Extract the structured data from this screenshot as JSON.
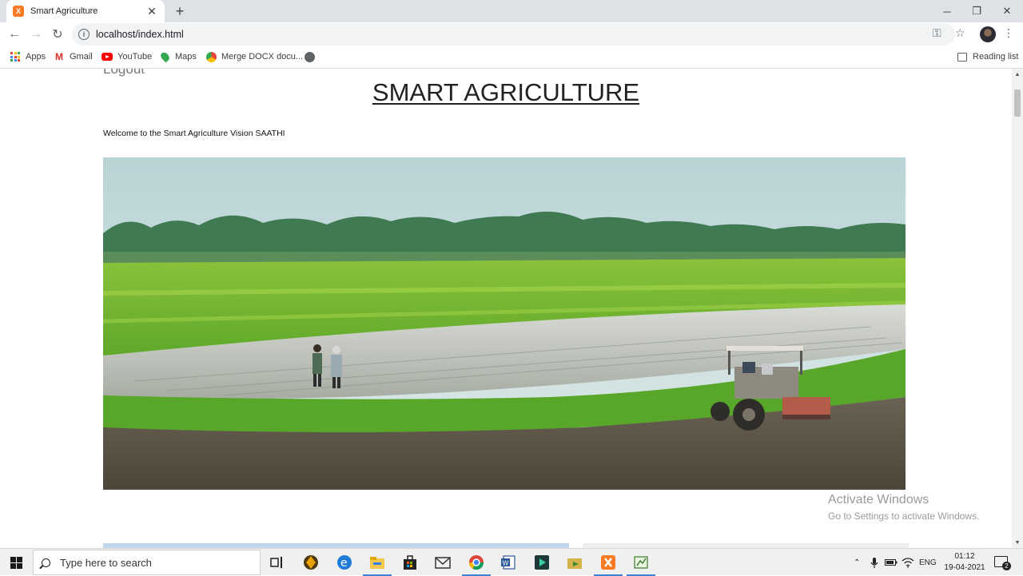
{
  "browser": {
    "tab": {
      "title": "Smart Agriculture",
      "favicon_text": "X"
    },
    "url": "localhost/index.html",
    "bookmarks": [
      {
        "label": "Apps",
        "icon": "apps-grid-icon"
      },
      {
        "label": "Gmail",
        "icon": "gmail-icon"
      },
      {
        "label": "YouTube",
        "icon": "youtube-icon"
      },
      {
        "label": "Maps",
        "icon": "maps-icon"
      },
      {
        "label": "Merge DOCX docu...",
        "icon": "merge-docx-icon"
      }
    ],
    "reading_list": "Reading list"
  },
  "page": {
    "logout": "Logout",
    "title": "SMART AGRICULTURE",
    "welcome": "Welcome to the Smart Agriculture Vision SAATHI",
    "hero_image": "rice-field-with-farmers-and-tractor"
  },
  "watermark": {
    "line1": "Activate Windows",
    "line2": "Go to Settings to activate Windows."
  },
  "taskbar": {
    "search_placeholder": "Type here to search",
    "language": "ENG",
    "time": "01:12",
    "date": "19-04-2021",
    "notification_count": "2"
  },
  "colors": {
    "accent": "#3b83d6",
    "tab_strip": "#dee1e6",
    "xampp_orange": "#fb7a24"
  }
}
